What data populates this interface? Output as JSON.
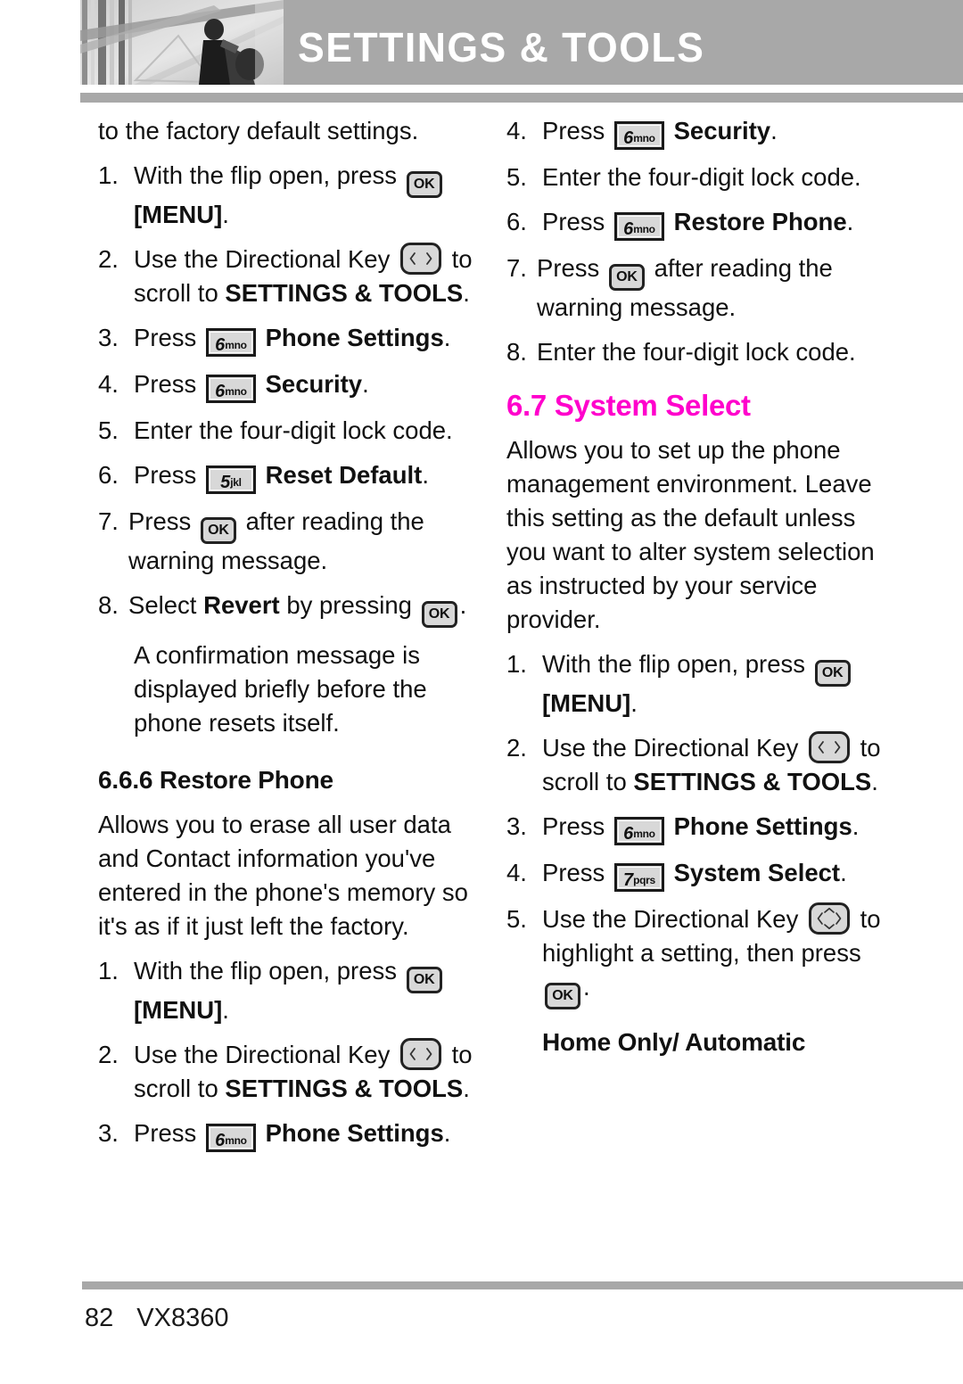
{
  "header": {
    "title": "SETTINGS & TOOLS",
    "photo_alt": "grayscale-photo-person-on-stairs"
  },
  "colors": {
    "header_bar": "#a8a8a8",
    "section_heading": "#ff00cc",
    "key_fill": "#d8d8d8",
    "key_border": "#1a1a1a",
    "text": "#111111"
  },
  "keys": {
    "ok": "OK",
    "five": {
      "digit": "5",
      "letters": "jkl"
    },
    "six": {
      "digit": "6",
      "letters": "mno"
    },
    "seven": {
      "digit": "7",
      "letters": "pqrs"
    },
    "dir_lr": "directional-key-left-right",
    "dir_4way": "directional-key-four-way"
  },
  "left_column": {
    "intro": "to the factory default settings.",
    "steps_reset": [
      {
        "num": "1.",
        "pre": "With the flip open, press",
        "key": "ok",
        "post": "",
        "bold_after": "[MENU]",
        "tail": "."
      },
      {
        "num": "2.",
        "pre": "Use the Directional Key",
        "key": "dir_lr",
        "post": "to scroll to",
        "bold_after": "SETTINGS & TOOLS",
        "tail": "."
      },
      {
        "num": "3.",
        "pre": "Press",
        "key": "six",
        "post": "",
        "bold_after": "Phone Settings",
        "tail": "."
      },
      {
        "num": "4.",
        "pre": "Press",
        "key": "six",
        "post": "",
        "bold_after": "Security",
        "tail": "."
      },
      {
        "num": "5.",
        "pre": "Enter the four-digit lock code.",
        "key": "",
        "post": "",
        "bold_after": "",
        "tail": ""
      },
      {
        "num": "6.",
        "pre": "Press",
        "key": "five",
        "post": "",
        "bold_after": "Reset Default",
        "tail": "."
      },
      {
        "num": "7.",
        "pre": "Press",
        "key": "ok",
        "post": "after reading the warning message.",
        "bold_after": "",
        "tail": ""
      },
      {
        "num": "8.",
        "pre": "Select",
        "key": "",
        "post": "",
        "bold_after": "",
        "tail": ""
      }
    ],
    "step8_text": {
      "lead": "Select",
      "bold": "Revert",
      "mid": "by pressing",
      "tail": "."
    },
    "confirmation": "A confirmation message is displayed briefly before the phone resets itself.",
    "subhead_restore": "6.6.6 Restore Phone",
    "restore_desc": "Allows you to erase all user data and Contact information you've entered in the phone's memory so it's as if it just left the factory.",
    "steps_restore": [
      {
        "num": "1.",
        "pre": "With the flip open, press",
        "bold_after": "[MENU]",
        "tail": "."
      },
      {
        "num": "2.",
        "pre": "Use the Directional Key",
        "post": "to scroll to",
        "bold_after": "SETTINGS & TOOLS",
        "tail": "."
      },
      {
        "num": "3.",
        "pre": "Press",
        "bold_after": "Phone Settings",
        "tail": "."
      }
    ]
  },
  "right_column": {
    "steps_restore_cont": [
      {
        "num": "4.",
        "pre": "Press",
        "bold_after": "Security",
        "tail": "."
      },
      {
        "num": "5.",
        "plain": "Enter the four-digit lock code."
      },
      {
        "num": "6.",
        "pre": "Press",
        "bold_after": "Restore Phone",
        "tail": "."
      },
      {
        "num": "7.",
        "pre": "Press",
        "post": "after reading the warning message."
      },
      {
        "num": "8.",
        "plain": "Enter the four-digit lock code."
      }
    ],
    "section_heading": "6.7 System Select",
    "section_desc": "Allows you to set up the phone management environment. Leave this setting as the default unless you want to alter system selection as instructed by your service provider.",
    "steps_system": [
      {
        "num": "1.",
        "pre": "With the flip open, press",
        "bold_after": "[MENU]",
        "tail": "."
      },
      {
        "num": "2.",
        "pre": "Use the Directional Key",
        "post": "to scroll to",
        "bold_after": "SETTINGS & TOOLS",
        "tail": "."
      },
      {
        "num": "3.",
        "pre": "Press",
        "bold_after": "Phone Settings",
        "tail": "."
      },
      {
        "num": "4.",
        "pre": "Press",
        "bold_after": "System Select",
        "tail": "."
      },
      {
        "num": "5.",
        "pre": "Use the Directional Key",
        "post": "to highlight a setting, then press",
        "tail": "."
      }
    ],
    "subhead_home": "Home Only/ Automatic"
  },
  "footer": {
    "page_number": "82",
    "model": "VX8360"
  }
}
